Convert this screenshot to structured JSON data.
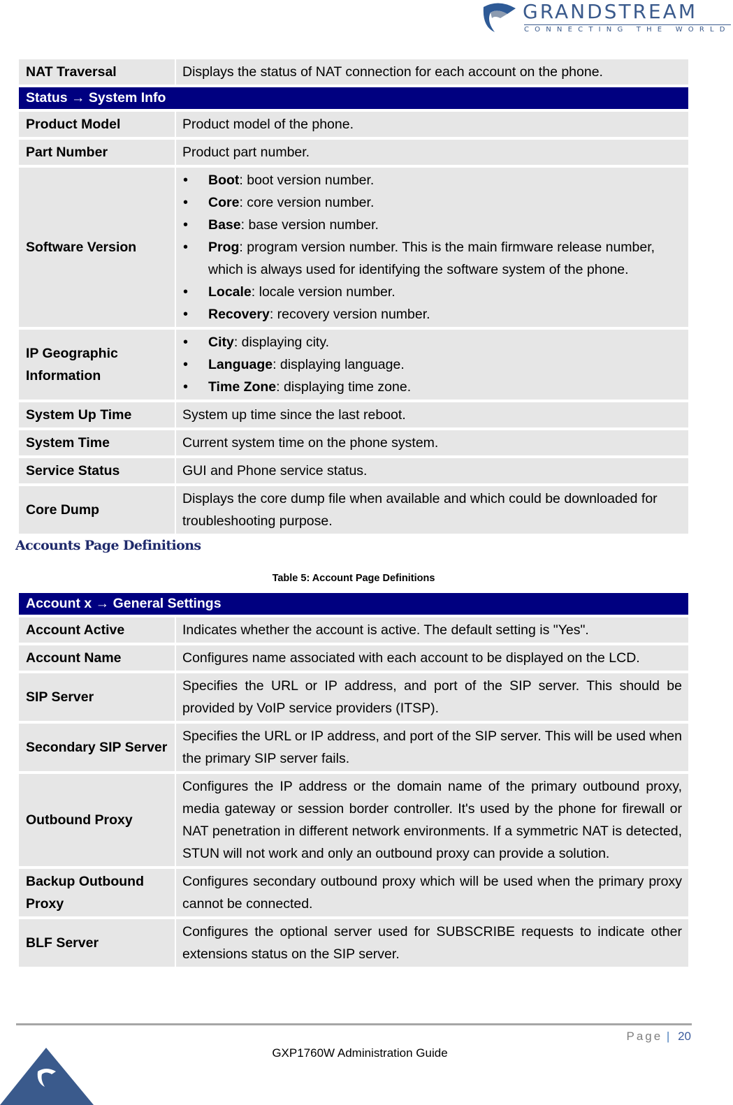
{
  "header": {
    "brand": "GRANDSTREAM",
    "tagline": "CONNECTING THE WORLD",
    "logo_icon": "grandstream-logo-icon"
  },
  "table1": {
    "rows_before": [
      {
        "label": "NAT Traversal",
        "value": "Displays the status of NAT connection for each account on the phone."
      }
    ],
    "section_header": "Status → System Info",
    "product_model": {
      "label": "Product Model",
      "value": "Product model of the phone."
    },
    "part_number": {
      "label": "Part Number",
      "value": "Product part number."
    },
    "software_version": {
      "label": "Software Version",
      "items": [
        {
          "term": "Boot",
          "desc": ": boot version number."
        },
        {
          "term": "Core",
          "desc": ": core version number."
        },
        {
          "term": "Base",
          "desc": ": base version number."
        },
        {
          "term": "Prog",
          "desc": ": program version number. This is the main firmware release number, which is always used for identifying the software system of the phone."
        },
        {
          "term": "Locale",
          "desc": ": locale version number."
        },
        {
          "term": "Recovery",
          "desc": ": recovery version number."
        }
      ]
    },
    "ip_geo": {
      "label": "IP Geographic Information",
      "items": [
        {
          "term": "City",
          "desc": ": displaying city."
        },
        {
          "term": "Language",
          "desc": ": displaying language."
        },
        {
          "term": "Time Zone",
          "desc": ": displaying time zone."
        }
      ]
    },
    "system_up_time": {
      "label": "System Up Time",
      "value": "System up time since the last reboot."
    },
    "system_time": {
      "label": "System Time",
      "value": "Current system time on the phone system."
    },
    "service_status": {
      "label": "Service Status",
      "value": "GUI and Phone service status."
    },
    "core_dump": {
      "label": "Core Dump",
      "value": "Displays the core dump file when available and which could be downloaded for troubleshooting purpose."
    }
  },
  "section": {
    "title": "Accounts Page Definitions",
    "caption": "Table 5: Account Page Definitions"
  },
  "table2": {
    "section_header": "Account x → General Settings",
    "rows": [
      {
        "label": "Account Active",
        "value": "Indicates whether the account is active. The default setting is \"Yes\"."
      },
      {
        "label": "Account Name",
        "value": "Configures name associated with each account to be displayed on the LCD."
      },
      {
        "label": "SIP Server",
        "value": "Specifies the URL or IP address, and port of the SIP server. This should be provided by VoIP service providers (ITSP)."
      },
      {
        "label": "Secondary SIP Server",
        "value": "Specifies the URL or IP address, and port of the SIP server. This will be used when the primary SIP server fails."
      },
      {
        "label": "Outbound Proxy",
        "value": "Configures the IP address or the domain name of the primary outbound proxy, media gateway or session border controller. It's used by the phone for firewall or NAT penetration in different network environments. If a symmetric NAT is detected, STUN will not work and only an outbound proxy can provide a solution."
      },
      {
        "label": "Backup Outbound Proxy",
        "value": "Configures secondary outbound proxy which will be used when the primary proxy cannot be connected."
      },
      {
        "label": "BLF Server",
        "value": "Configures the optional server used for SUBSCRIBE requests to indicate other extensions status on the SIP server."
      }
    ]
  },
  "footer": {
    "page_label": "Page",
    "separator": "|",
    "page_number": "20",
    "guide_title": "GXP1760W Administration Guide"
  },
  "colors": {
    "header_bg": "#000080",
    "cell_bg": "#e6e6e6",
    "section_title": "#1f2a6b",
    "brand": "#3a5a8c"
  }
}
